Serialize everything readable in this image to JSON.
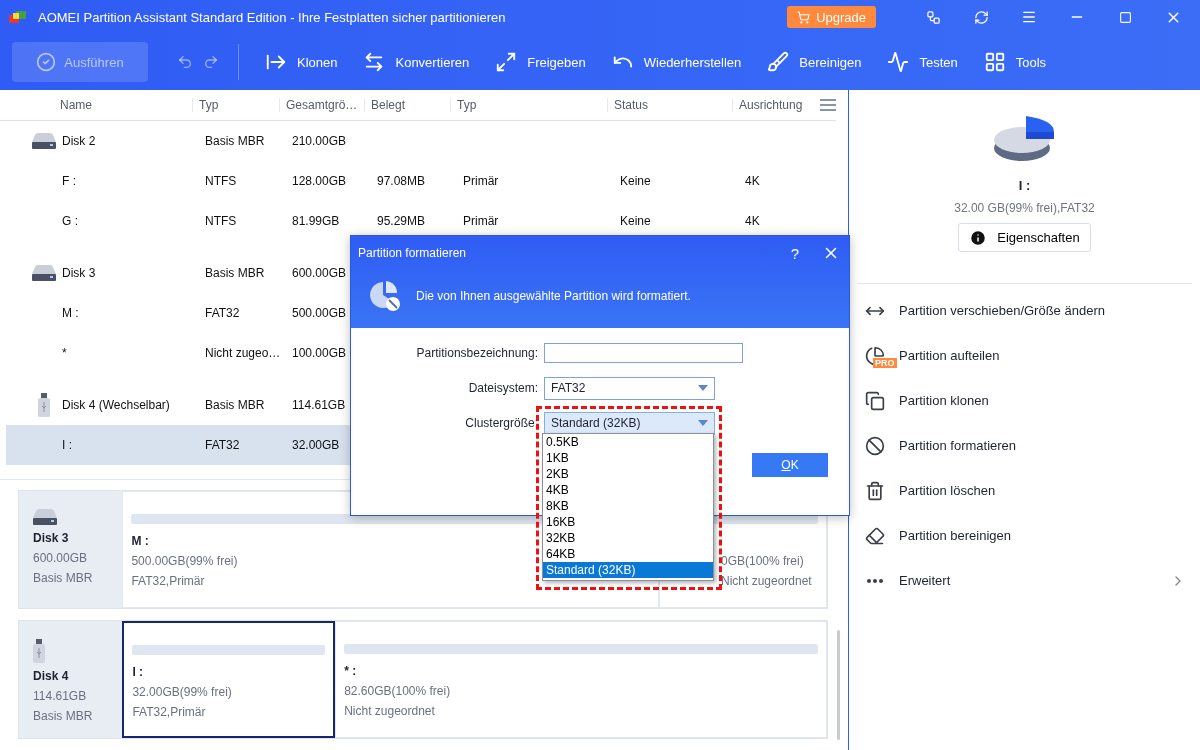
{
  "window": {
    "title": "AOMEI Partition Assistant Standard Edition - Ihre Festplatten sicher partitionieren",
    "upgrade": "Upgrade"
  },
  "toolbar": {
    "apply": {
      "label": "Ausführen",
      "disabled": true
    },
    "items": [
      {
        "kind": "clone",
        "label": "Klonen"
      },
      {
        "kind": "convert",
        "label": "Konvertieren"
      },
      {
        "kind": "free",
        "label": "Freigeben"
      },
      {
        "kind": "restore",
        "label": "Wiederherstellen"
      },
      {
        "kind": "clean",
        "label": "Bereinigen"
      },
      {
        "kind": "test",
        "label": "Testen"
      },
      {
        "kind": "tools",
        "label": "Tools"
      }
    ]
  },
  "table": {
    "columns": [
      "Name",
      "Typ",
      "Gesamtgrö…",
      "Belegt",
      "Typ",
      "Status",
      "Ausrichtung"
    ],
    "rows": [
      {
        "kind": "hdd",
        "selected": false,
        "cells": [
          "Disk 2",
          "Basis MBR",
          "210.00GB"
        ]
      },
      {
        "kind": "partition",
        "selected": false,
        "cells": [
          "F :",
          "NTFS",
          "128.00GB",
          "97.08MB",
          "Primär",
          "Keine",
          "4K"
        ]
      },
      {
        "kind": "partition",
        "selected": false,
        "cells": [
          "G :",
          "NTFS",
          "81.99GB",
          "95.29MB",
          "Primär",
          "Keine",
          "4K"
        ]
      },
      {
        "kind": "hdd",
        "selected": false,
        "cells": [
          "Disk 3",
          "Basis MBR",
          "600.00GB"
        ]
      },
      {
        "kind": "partition",
        "selected": false,
        "cells": [
          "M :",
          "FAT32",
          "500.00GB"
        ]
      },
      {
        "kind": "partition",
        "selected": false,
        "cells": [
          "*",
          "Nicht zugeo…",
          "100.00GB"
        ]
      },
      {
        "kind": "usb",
        "selected": false,
        "cells": [
          "Disk 4 (Wechselbar)",
          "Basis MBR",
          "114.61GB"
        ]
      },
      {
        "kind": "partition",
        "selected": true,
        "cells": [
          "I :",
          "FAT32",
          "32.00GB"
        ]
      }
    ]
  },
  "disk_map": [
    {
      "kind": "hdd",
      "name": "Disk 3",
      "size": "600.00GB",
      "type": "Basis MBR",
      "partitions": [
        {
          "name": "M :",
          "size": "500.00GB(99% frei)",
          "info": "FAT32,Primär",
          "selected": false
        },
        {
          "size": "0GB(100% frei)",
          "info": "Nicht zugeordnet",
          "selected": false
        }
      ]
    },
    {
      "kind": "usb",
      "name": "Disk 4",
      "size": "114.61GB",
      "type": "Basis MBR",
      "partitions": [
        {
          "name": "I :",
          "size": "32.00GB(99% frei)",
          "info": "FAT32,Primär",
          "selected": true
        },
        {
          "name": "* :",
          "size": "82.60GB(100% frei)",
          "info": "Nicht zugeordnet",
          "selected": false
        }
      ]
    }
  ],
  "right_panel": {
    "name": "I :",
    "details": "32.00 GB(99% frei),FAT32",
    "properties": "Eigenschaften",
    "actions": [
      {
        "kind": "move",
        "label": "Partition verschieben/Größe ändern",
        "submenu": false
      },
      {
        "kind": "split",
        "label": "Partition aufteilen",
        "badge": "PRO",
        "submenu": false
      },
      {
        "kind": "clone",
        "label": "Partition klonen",
        "submenu": false
      },
      {
        "kind": "format",
        "label": "Partition formatieren",
        "submenu": false
      },
      {
        "kind": "delete",
        "label": "Partition löschen",
        "submenu": false
      },
      {
        "kind": "wipe",
        "label": "Partition bereinigen",
        "submenu": false
      },
      {
        "kind": "more",
        "label": "Erweitert",
        "submenu": true
      }
    ]
  },
  "dialog": {
    "title": "Partition formatieren",
    "help": "?",
    "message": "Die von Ihnen ausgewählte Partition wird formatiert.",
    "fields": [
      {
        "kind": "text",
        "label": "Partitionsbezeichnung:",
        "highlight": false
      },
      {
        "kind": "select",
        "label": "Dateisystem:",
        "value": "FAT32",
        "highlight": false,
        "open": false
      },
      {
        "kind": "select",
        "label": "Clustergröße:",
        "value": "Standard (32KB)",
        "highlight": true,
        "open": true
      }
    ],
    "options": [
      {
        "label": "0.5KB",
        "selected": false
      },
      {
        "label": "1KB",
        "selected": false
      },
      {
        "label": "2KB",
        "selected": false
      },
      {
        "label": "4KB",
        "selected": false
      },
      {
        "label": "8KB",
        "selected": false
      },
      {
        "label": "16KB",
        "selected": false
      },
      {
        "label": "32KB",
        "selected": false
      },
      {
        "label": "64KB",
        "selected": false
      },
      {
        "label": "Standard (32KB)",
        "selected": true
      }
    ],
    "ok": "OK"
  }
}
